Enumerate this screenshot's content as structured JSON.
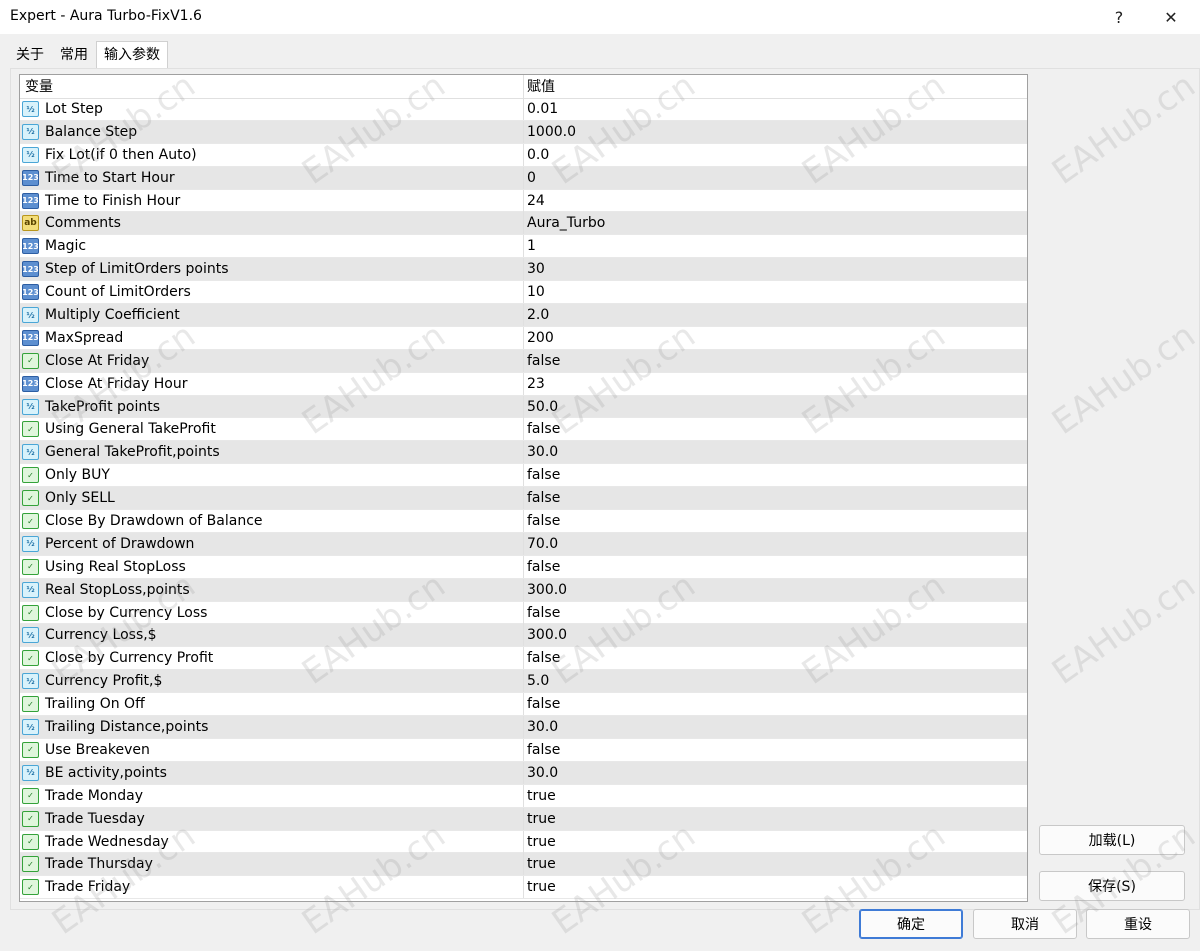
{
  "window": {
    "title": "Expert - Aura Turbo-FixV1.6",
    "help_glyph": "?",
    "close_glyph": "✕"
  },
  "tabs": [
    {
      "label": "关于"
    },
    {
      "label": "常用"
    },
    {
      "label": "输入参数",
      "active": true
    }
  ],
  "grid": {
    "col_variable": "变量",
    "col_value": "赋值",
    "rows": [
      {
        "type": "double",
        "name": "Lot Step",
        "value": "0.01"
      },
      {
        "type": "double",
        "name": "Balance Step",
        "value": "1000.0"
      },
      {
        "type": "double",
        "name": "Fix Lot(if 0 then Auto)",
        "value": "0.0"
      },
      {
        "type": "int",
        "name": "Time to Start Hour",
        "value": "0"
      },
      {
        "type": "int",
        "name": "Time to Finish Hour",
        "value": "24"
      },
      {
        "type": "string",
        "name": "Comments",
        "value": "Aura_Turbo"
      },
      {
        "type": "int",
        "name": "Magic",
        "value": "1"
      },
      {
        "type": "int",
        "name": "Step of LimitOrders points",
        "value": "30"
      },
      {
        "type": "int",
        "name": "Count of LimitOrders",
        "value": "10"
      },
      {
        "type": "double",
        "name": "Multiply Coefficient",
        "value": "2.0"
      },
      {
        "type": "int",
        "name": "MaxSpread",
        "value": "200"
      },
      {
        "type": "bool",
        "name": "Close At Friday",
        "value": "false"
      },
      {
        "type": "int",
        "name": "Close At Friday Hour",
        "value": "23"
      },
      {
        "type": "double",
        "name": "TakeProfit points",
        "value": "50.0"
      },
      {
        "type": "bool",
        "name": "Using General TakeProfit",
        "value": "false"
      },
      {
        "type": "double",
        "name": "General TakeProfit,points",
        "value": "30.0"
      },
      {
        "type": "bool",
        "name": "Only BUY",
        "value": "false"
      },
      {
        "type": "bool",
        "name": "Only SELL",
        "value": "false"
      },
      {
        "type": "bool",
        "name": "Close By Drawdown of Balance",
        "value": "false"
      },
      {
        "type": "double",
        "name": "Percent of Drawdown",
        "value": "70.0"
      },
      {
        "type": "bool",
        "name": "Using Real StopLoss",
        "value": "false"
      },
      {
        "type": "double",
        "name": "Real StopLoss,points",
        "value": "300.0"
      },
      {
        "type": "bool",
        "name": "Close by Currency Loss",
        "value": "false"
      },
      {
        "type": "double",
        "name": "Currency Loss,$",
        "value": "300.0"
      },
      {
        "type": "bool",
        "name": "Close by Currency Profit",
        "value": "false"
      },
      {
        "type": "double",
        "name": "Currency Profit,$",
        "value": "5.0"
      },
      {
        "type": "bool",
        "name": "Trailing On Off",
        "value": "false"
      },
      {
        "type": "double",
        "name": "Trailing Distance,points",
        "value": "30.0"
      },
      {
        "type": "bool",
        "name": "Use Breakeven",
        "value": "false"
      },
      {
        "type": "double",
        "name": "BE activity,points",
        "value": "30.0"
      },
      {
        "type": "bool",
        "name": "Trade Monday",
        "value": "true"
      },
      {
        "type": "bool",
        "name": "Trade Tuesday",
        "value": "true"
      },
      {
        "type": "bool",
        "name": "Trade Wednesday",
        "value": "true"
      },
      {
        "type": "bool",
        "name": "Trade Thursday",
        "value": "true"
      },
      {
        "type": "bool",
        "name": "Trade Friday",
        "value": "true"
      }
    ]
  },
  "icon_text": {
    "double": "½",
    "int": "123",
    "string": "ab",
    "bool": "✓"
  },
  "buttons": {
    "load": "加载(L)",
    "save": "保存(S)",
    "ok": "确定",
    "cancel": "取消",
    "reset": "重设"
  },
  "watermark_text": "EAHub.cn",
  "colors": {
    "row_alt": "#e6e6e6",
    "accent": "#3f7bd6"
  }
}
